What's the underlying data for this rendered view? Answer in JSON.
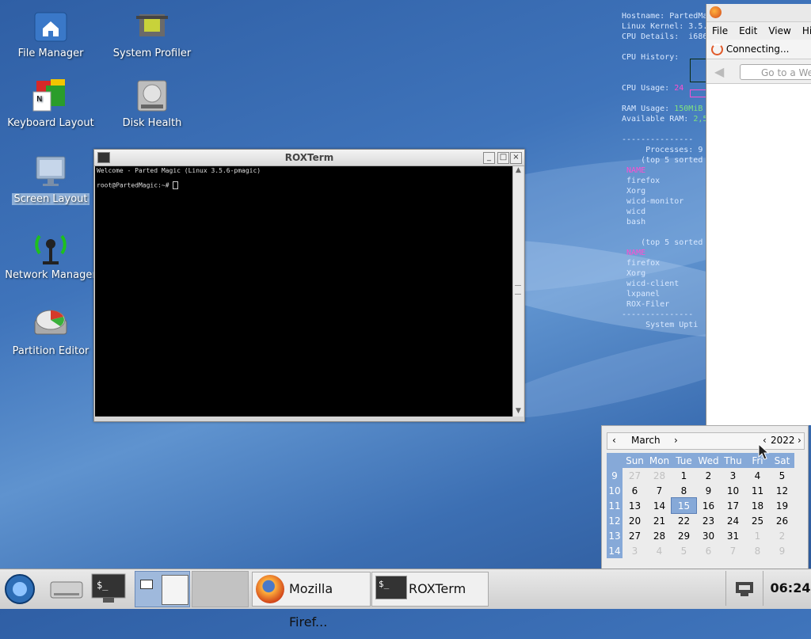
{
  "desktop_icons": [
    {
      "label": "File Manager",
      "icon": "home-folder-icon"
    },
    {
      "label": "System Profiler",
      "icon": "chip-icon"
    },
    {
      "label": "Keyboard Layout",
      "icon": "keyboard-flags-icon"
    },
    {
      "label": "Disk Health",
      "icon": "hard-disk-icon"
    },
    {
      "label": "Screen Layout",
      "icon": "monitor-icon",
      "selected": true
    },
    {
      "label": "Network Manager",
      "icon": "antenna-icon"
    },
    {
      "label": "Partition Editor",
      "icon": "disk-pie-icon"
    }
  ],
  "conky": {
    "hostname": "Hostname: PartedMa",
    "kernel": "Linux Kernel: 3.5.",
    "cpu_details": "CPU Details:  i686",
    "cpu_history": "CPU History:",
    "cpu_usage_label": "CPU Usage:",
    "cpu_usage_value": "24",
    "ram_usage_label": "RAM Usage:",
    "ram_usage_value": "150MiB",
    "available_ram_label": "Available RAM:",
    "available_ram_value": "2,5",
    "separator": "---------------",
    "processes": "     Processes: 9",
    "top_cpu": "    (top 5 sorted",
    "name_header": "NAME",
    "cpu_procs": [
      "firefox",
      "Xorg",
      "wicd-monitor",
      "wicd",
      "bash"
    ],
    "top_mem": "    (top 5 sorted",
    "mem_procs": [
      "firefox",
      "Xorg",
      "wicd-client",
      "lxpanel",
      "ROX-Filer"
    ],
    "uptime": "     System Upti"
  },
  "terminal": {
    "title": "ROXTerm",
    "line1": "Welcome - Parted Magic (Linux 3.5.6-pmagic)",
    "prompt": "root@PartedMagic:~# "
  },
  "firefox": {
    "menu": [
      "File",
      "Edit",
      "View",
      "His"
    ],
    "tab_label": "Connecting...",
    "url_placeholder": "Go to a We"
  },
  "calendar": {
    "month": "March",
    "year": "2022",
    "weekdays": [
      "Sun",
      "Mon",
      "Tue",
      "Wed",
      "Thu",
      "Fri",
      "Sat"
    ],
    "weeks": [
      {
        "num": "9",
        "days": [
          "27",
          "28",
          "1",
          "2",
          "3",
          "4",
          "5"
        ]
      },
      {
        "num": "10",
        "days": [
          "6",
          "7",
          "8",
          "9",
          "10",
          "11",
          "12"
        ]
      },
      {
        "num": "11",
        "days": [
          "13",
          "14",
          "15",
          "16",
          "17",
          "18",
          "19"
        ]
      },
      {
        "num": "12",
        "days": [
          "20",
          "21",
          "22",
          "23",
          "24",
          "25",
          "26"
        ]
      },
      {
        "num": "13",
        "days": [
          "27",
          "28",
          "29",
          "30",
          "31",
          "1",
          "2"
        ]
      },
      {
        "num": "14",
        "days": [
          "3",
          "4",
          "5",
          "6",
          "7",
          "8",
          "9"
        ]
      }
    ],
    "today": "15"
  },
  "taskbar": {
    "firefox_label": "Mozilla Firef...",
    "roxterm_label": "ROXTerm",
    "clock": "06:24"
  }
}
